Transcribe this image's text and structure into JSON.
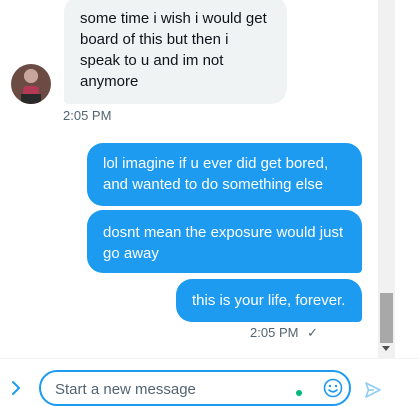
{
  "conversation": {
    "incoming": [
      {
        "text": "some time i wish i would get board of this but then i speak to u and im  not anymore",
        "time": "2:05 PM"
      }
    ],
    "outgoing": [
      {
        "text": "lol imagine if u ever did get bored, and wanted to do something else"
      },
      {
        "text": "dosnt mean the exposure would just go away"
      },
      {
        "text": "this is your life, forever."
      }
    ],
    "outgoing_time": "2:05 PM",
    "read_receipt": "✓"
  },
  "composer": {
    "placeholder": "Start a new message"
  },
  "icons": {
    "expand": "chevron-right-icon",
    "emoji": "emoji-icon",
    "send": "send-icon",
    "status": "online-dot-icon"
  },
  "colors": {
    "accent": "#1d9bf0",
    "incoming_bubble": "#eff3f4",
    "secondary_text": "#536471",
    "online": "#00ba7c"
  }
}
